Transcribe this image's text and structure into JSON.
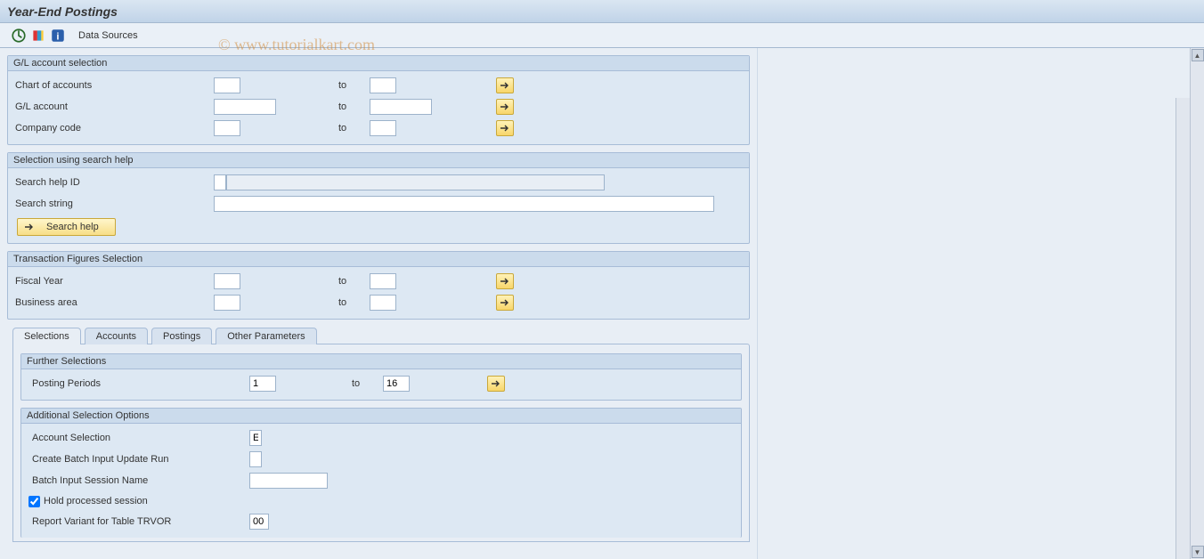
{
  "watermark": "© www.tutorialkart.com",
  "titlebar": {
    "title": "Year-End Postings"
  },
  "toolbar": {
    "data_sources": "Data Sources"
  },
  "groups": {
    "gl_selection": {
      "title": "G/L account selection",
      "chart_of_accounts": "Chart of accounts",
      "gl_account": "G/L account",
      "company_code": "Company code",
      "to": "to"
    },
    "search_help": {
      "title": "Selection using search help",
      "search_help_id": "Search help ID",
      "search_string": "Search string",
      "button": "Search help"
    },
    "trans_figures": {
      "title": "Transaction Figures Selection",
      "fiscal_year": "Fiscal Year",
      "business_area": "Business area",
      "to": "to"
    }
  },
  "tabs": {
    "selections": "Selections",
    "accounts": "Accounts",
    "postings": "Postings",
    "other": "Other Parameters"
  },
  "further": {
    "title": "Further Selections",
    "posting_periods": "Posting Periods",
    "from_val": "1",
    "to_val": "16",
    "to": "to"
  },
  "additional": {
    "title": "Additional Selection Options",
    "account_selection": "Account Selection",
    "account_selection_val": "E",
    "create_batch": "Create Batch Input Update Run",
    "batch_session": "Batch Input Session Name",
    "hold_processed": "Hold processed session",
    "report_variant": "Report Variant for Table TRVOR",
    "report_variant_val": "00"
  }
}
